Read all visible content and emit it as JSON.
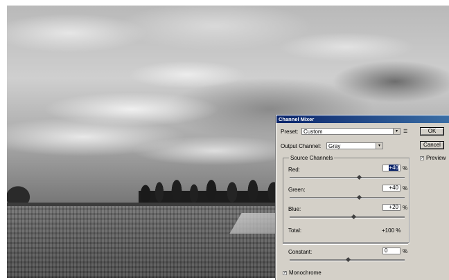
{
  "dialog": {
    "title": "Channel Mixer",
    "preset_label": "Preset:",
    "preset_value": "Custom",
    "output_channel_label": "Output Channel:",
    "output_channel_value": "Gray",
    "ok_label": "OK",
    "cancel_label": "Cancel",
    "preview_label": "Preview",
    "preview_checked": true,
    "source_channels_label": "Source Channels",
    "percent_symbol": "%",
    "red_label": "Red:",
    "red_value": "+40",
    "green_label": "Green:",
    "green_value": "+40",
    "blue_label": "Blue:",
    "blue_value": "+20",
    "total_label": "Total:",
    "total_value": "+100 %",
    "constant_label": "Constant:",
    "constant_value": "0",
    "monochrome_label": "Monochrome",
    "monochrome_checked": true,
    "options_icon": "options-menu-icon",
    "checkmark_glyph": "✓",
    "dropdown_glyph": "▾",
    "menu_glyph": "☰"
  },
  "photo": {
    "description_icon": "landscape-photo"
  },
  "colors": {
    "titlebar": "#0a246a",
    "dialog_bg": "#d4d0c8"
  }
}
